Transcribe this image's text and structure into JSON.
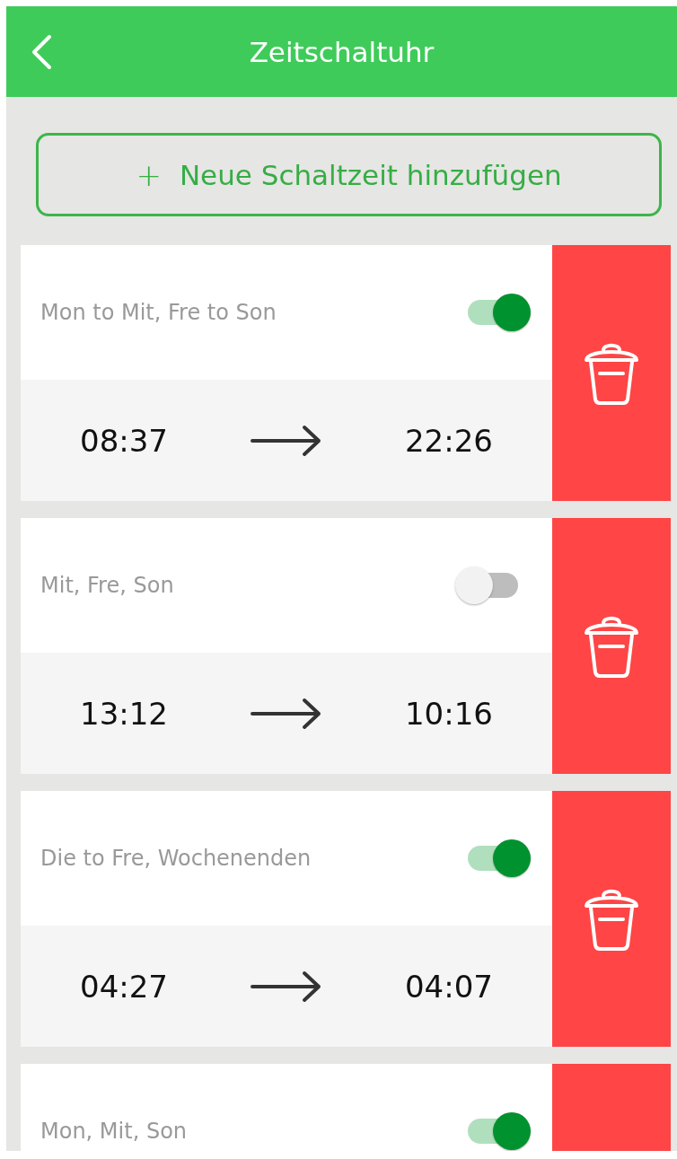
{
  "header": {
    "title": "Zeitschaltuhr"
  },
  "add_button": {
    "icon": "+",
    "label": "Neue Schaltzeit hinzufügen"
  },
  "schedules": [
    {
      "days": "Mon to Mit, Fre to Son",
      "on": true,
      "start": "08:37",
      "end": "22:26"
    },
    {
      "days": "Mit, Fre, Son",
      "on": false,
      "start": "13:12",
      "end": "10:16"
    },
    {
      "days": "Die to Fre, Wochenenden",
      "on": true,
      "start": "04:27",
      "end": "04:07"
    },
    {
      "days": "Mon, Mit, Son",
      "on": true
    }
  ]
}
